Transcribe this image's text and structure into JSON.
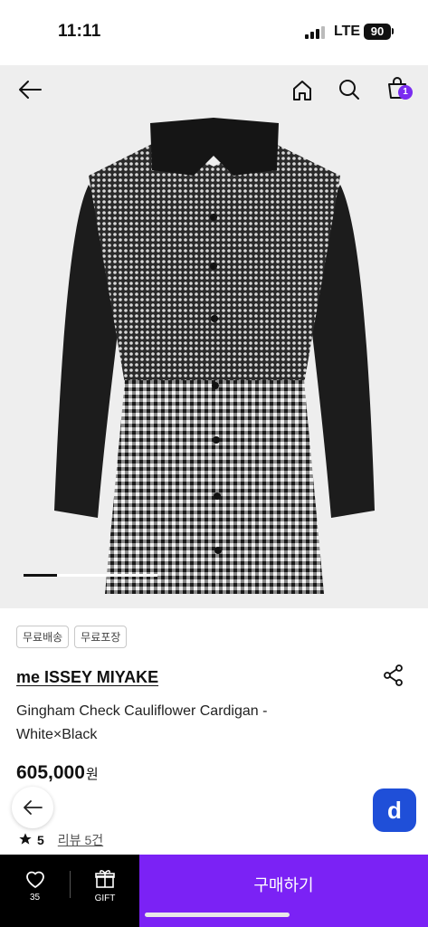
{
  "status_bar": {
    "time": "11:11",
    "network": "LTE",
    "battery": "90"
  },
  "top_nav": {
    "cart_count": "1"
  },
  "gallery": {
    "progress": 0.25
  },
  "badges": [
    "무료배송",
    "무료포장"
  ],
  "product": {
    "brand": "me ISSEY MIYAKE",
    "name": "Gingham Check Cauliflower Cardigan - White×Black",
    "price": "605,000",
    "price_unit": "원",
    "rating": "5",
    "review_link": "리뷰 5건"
  },
  "float": {
    "d_label": "d"
  },
  "bottom_bar": {
    "wish_count": "35",
    "gift_label": "GIFT",
    "buy_label": "구매하기"
  },
  "colors": {
    "accent": "#7b22f5",
    "d_button": "#1f4fd8"
  }
}
